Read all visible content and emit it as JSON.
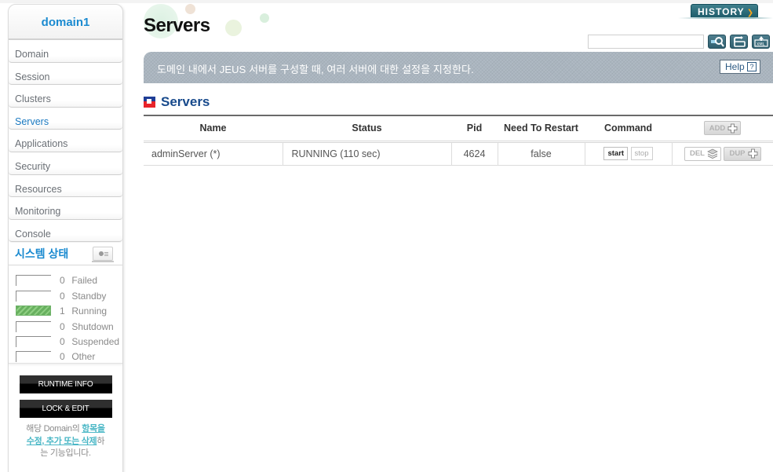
{
  "sidebar": {
    "domain_name": "domain1",
    "nav_items": [
      {
        "label": "Domain",
        "active": false
      },
      {
        "label": "Session",
        "active": false
      },
      {
        "label": "Clusters",
        "active": false
      },
      {
        "label": "Servers",
        "active": true
      },
      {
        "label": "Applications",
        "active": false
      },
      {
        "label": "Security",
        "active": false
      },
      {
        "label": "Resources",
        "active": false
      },
      {
        "label": "Monitoring",
        "active": false
      },
      {
        "label": "Console",
        "active": false
      }
    ],
    "system_status": {
      "title": "시스템 상태",
      "icon": "monitor-chart-icon",
      "items": [
        {
          "count": "0",
          "label": "Failed"
        },
        {
          "count": "0",
          "label": "Standby"
        },
        {
          "count": "1",
          "label": "Running"
        },
        {
          "count": "0",
          "label": "Shutdown"
        },
        {
          "count": "0",
          "label": "Suspended"
        },
        {
          "count": "0",
          "label": "Other"
        }
      ]
    },
    "runtime_info_label": "RUNTIME INFO",
    "lock_edit_label": "LOCK & EDIT",
    "info_prefix": "해당 Domain의 ",
    "info_link": "항목을 수정, 추가 또는 삭제",
    "info_suffix": "하는 기능입니다."
  },
  "header": {
    "page_title": "Servers",
    "history_label": "HISTORY",
    "search_value": "",
    "icons": [
      "search-icon",
      "refresh-icon",
      "xml-export-icon"
    ]
  },
  "description": {
    "text": "도메인 내에서 JEUS 서버를 구성할 때, 여러 서버에 대한 설정을 지정한다.",
    "help_label": "Help",
    "help_icon": "?"
  },
  "section": {
    "title": "Servers"
  },
  "table": {
    "columns": [
      "Name",
      "Status",
      "Pid",
      "Need To Restart",
      "Command"
    ],
    "add_label": "ADD",
    "rows": [
      {
        "name": "adminServer (*)",
        "status": "RUNNING (110 sec)",
        "pid": "4624",
        "need_restart": "false",
        "start_label": "start",
        "stop_label": "stop",
        "del_label": "DEL",
        "dup_label": "DUP"
      }
    ]
  },
  "colors": {
    "accent_blue": "#1a8ad0",
    "history_teal": "#2a6b7a",
    "running_green": "#68b05f",
    "link_teal": "#4ab7c6"
  }
}
